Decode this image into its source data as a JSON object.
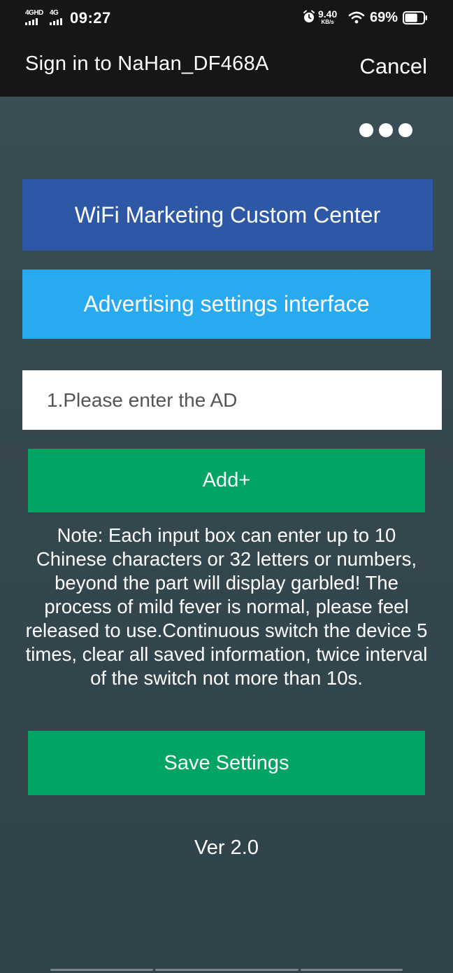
{
  "status_bar": {
    "signal_1_label": "4GHD",
    "signal_2_label": "4G",
    "time": "09:27",
    "speed_value": "9.40",
    "speed_unit": "KB/s",
    "battery_percent": "69%",
    "battery_level": 0.69
  },
  "header": {
    "title": "Sign in to NaHan_DF468A",
    "cancel_label": "Cancel"
  },
  "main": {
    "banner_primary": "WiFi Marketing Custom Center",
    "banner_secondary": "Advertising settings interface",
    "ad_input": {
      "placeholder": "1.Please enter the AD",
      "value": ""
    },
    "add_button_label": "Add+",
    "note": "Note: Each input box can enter up to 10 Chinese characters or 32 letters or numbers, beyond the part will display garbled! The process of mild fever is normal, please feel released to use.Continuous switch the device 5 times, clear all saved information, twice interval of the switch not more than 10s.",
    "save_button_label": "Save Settings",
    "version": "Ver 2.0"
  },
  "colors": {
    "header_bg": "#161616",
    "background": "#3a4c54",
    "banner_primary": "#2e58a6",
    "banner_secondary": "#27aaf0",
    "button_green": "#00a564"
  }
}
